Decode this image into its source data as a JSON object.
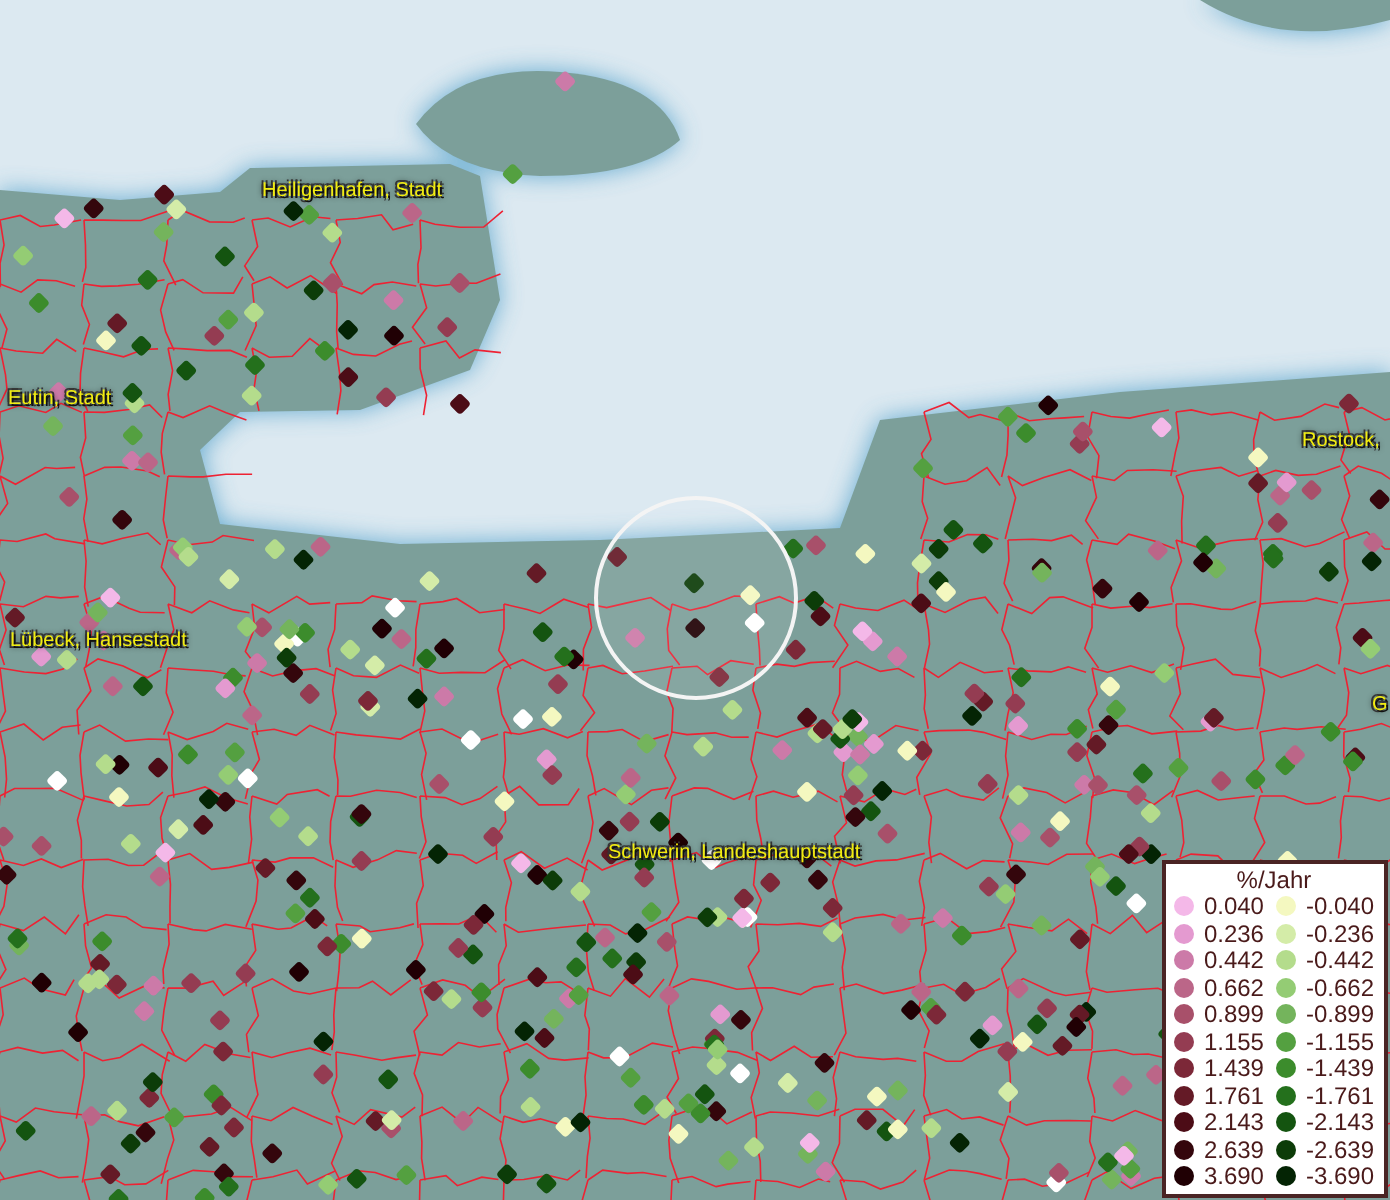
{
  "map": {
    "places": [
      {
        "name": "Heiligenhafen, Stadt"
      },
      {
        "name": "Eutin, Stadt"
      },
      {
        "name": "Rostock,"
      },
      {
        "name": "Lübeck, Hansestadt"
      },
      {
        "name": "G"
      },
      {
        "name": "Schwerin, Landeshauptstadt"
      }
    ]
  },
  "legend": {
    "title": "%/Jahr",
    "columns": [
      [
        {
          "label": "0.040",
          "color": "#f4b8e8"
        },
        {
          "label": "0.236",
          "color": "#e49ad0"
        },
        {
          "label": "0.442",
          "color": "#cc7aa8"
        },
        {
          "label": "0.662",
          "color": "#bb6688"
        },
        {
          "label": "0.899",
          "color": "#a8506a"
        },
        {
          "label": "1.155",
          "color": "#943c52"
        },
        {
          "label": "1.439",
          "color": "#7c2838"
        },
        {
          "label": "1.761",
          "color": "#641a26"
        },
        {
          "label": "2.143",
          "color": "#4c0c16"
        },
        {
          "label": "2.639",
          "color": "#34060c"
        },
        {
          "label": "3.690",
          "color": "#200004"
        }
      ],
      [
        {
          "label": "-0.040",
          "color": "#f4f8c0"
        },
        {
          "label": "-0.236",
          "color": "#d4eca8"
        },
        {
          "label": "-0.442",
          "color": "#b4dc8c"
        },
        {
          "label": "-0.662",
          "color": "#94cc74"
        },
        {
          "label": "-0.899",
          "color": "#74b45c"
        },
        {
          "label": "-1.155",
          "color": "#54a040"
        },
        {
          "label": "-1.439",
          "color": "#3c8c2c"
        },
        {
          "label": "-1.761",
          "color": "#24701c"
        },
        {
          "label": "-2.143",
          "color": "#145410"
        },
        {
          "label": "-2.639",
          "color": "#0c3c08"
        },
        {
          "label": "-3.690",
          "color": "#042404"
        }
      ]
    ]
  }
}
